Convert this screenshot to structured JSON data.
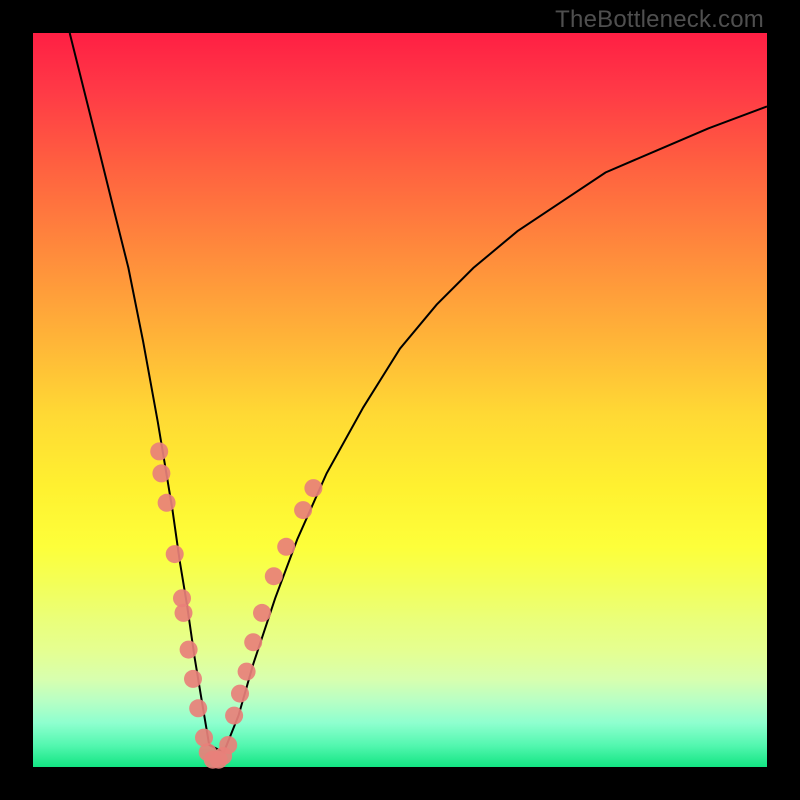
{
  "watermark": "TheBottleneck.com",
  "chart_data": {
    "type": "line",
    "title": "",
    "xlabel": "",
    "ylabel": "",
    "xlim": [
      0,
      100
    ],
    "ylim": [
      0,
      100
    ],
    "series": [
      {
        "name": "bottleneck-curve",
        "x": [
          5,
          7,
          9,
          11,
          13,
          15,
          17,
          19,
          20,
          21,
          22,
          23,
          24,
          26,
          28,
          30,
          33,
          36,
          40,
          45,
          50,
          55,
          60,
          66,
          72,
          78,
          85,
          92,
          100
        ],
        "y": [
          100,
          92,
          84,
          76,
          68,
          58,
          47,
          35,
          28,
          22,
          15,
          9,
          3,
          2,
          7,
          14,
          23,
          31,
          40,
          49,
          57,
          63,
          68,
          73,
          77,
          81,
          84,
          87,
          90
        ]
      }
    ],
    "markers": [
      {
        "x": 17.2,
        "y": 43
      },
      {
        "x": 17.5,
        "y": 40
      },
      {
        "x": 18.2,
        "y": 36
      },
      {
        "x": 19.3,
        "y": 29
      },
      {
        "x": 20.3,
        "y": 23
      },
      {
        "x": 20.5,
        "y": 21
      },
      {
        "x": 21.2,
        "y": 16
      },
      {
        "x": 21.8,
        "y": 12
      },
      {
        "x": 22.5,
        "y": 8
      },
      {
        "x": 23.3,
        "y": 4
      },
      {
        "x": 23.8,
        "y": 2
      },
      {
        "x": 24.5,
        "y": 1
      },
      {
        "x": 25.3,
        "y": 1
      },
      {
        "x": 25.9,
        "y": 1.5
      },
      {
        "x": 26.6,
        "y": 3
      },
      {
        "x": 27.4,
        "y": 7
      },
      {
        "x": 28.2,
        "y": 10
      },
      {
        "x": 29.1,
        "y": 13
      },
      {
        "x": 30.0,
        "y": 17
      },
      {
        "x": 31.2,
        "y": 21
      },
      {
        "x": 32.8,
        "y": 26
      },
      {
        "x": 34.5,
        "y": 30
      },
      {
        "x": 36.8,
        "y": 35
      },
      {
        "x": 38.2,
        "y": 38
      }
    ],
    "gradient_meaning": "vertical color gradient encodes y-value severity: red (high/bad) at top through yellow mid to green (low/good) at bottom"
  }
}
